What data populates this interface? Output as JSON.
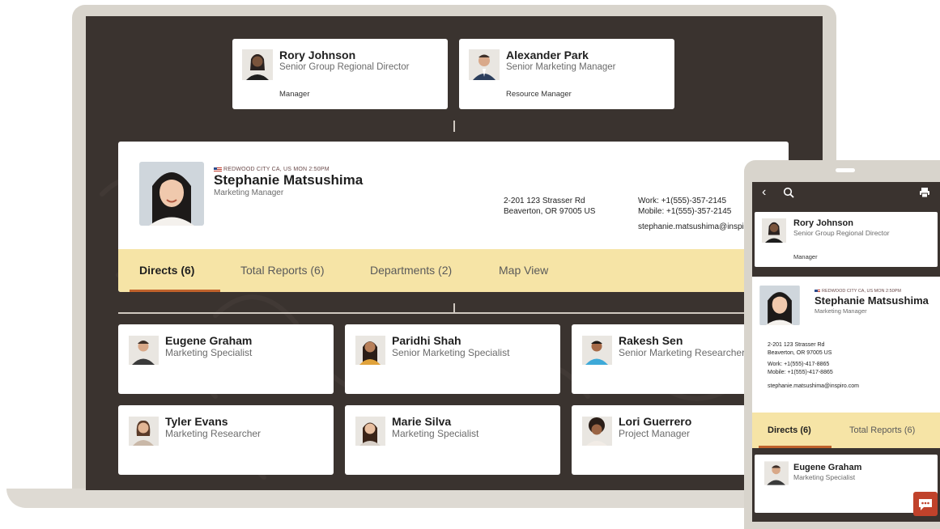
{
  "managers": [
    {
      "name": "Rory Johnson",
      "title": "Senior Group Regional Director",
      "role": "Manager"
    },
    {
      "name": "Alexander Park",
      "title": "Senior Marketing Manager",
      "role": "Resource Manager"
    }
  ],
  "profile": {
    "location": "REDWOOD CITY CA, US MON 2:50PM",
    "name": "Stephanie Matsushima",
    "title": "Marketing Manager",
    "address_line1": "2-201 123 Strasser Rd",
    "address_line2": "Beaverton, OR 97005 US",
    "work_phone": "Work: +1(555)-357-2145",
    "mobile_phone": "Mobile: +1(555)-357-2145",
    "email": "stephanie.matsushima@inspi"
  },
  "tabs": [
    {
      "label": "Directs (6)",
      "active": true
    },
    {
      "label": "Total Reports (6)",
      "active": false
    },
    {
      "label": "Departments (2)",
      "active": false
    },
    {
      "label": "Map View",
      "active": false
    }
  ],
  "directs": [
    {
      "name": "Eugene Graham",
      "title": "Marketing Specialist"
    },
    {
      "name": "Paridhi Shah",
      "title": "Senior Marketing Specialist"
    },
    {
      "name": "Rakesh Sen",
      "title": "Senior Marketing Researcher"
    },
    {
      "name": "Tyler Evans",
      "title": "Marketing Researcher"
    },
    {
      "name": "Marie Silva",
      "title": "Marketing Specialist"
    },
    {
      "name": "Lori Guerrero",
      "title": "Project Manager"
    }
  ],
  "tablet": {
    "icons": [
      "back-chevron-icon",
      "search-icon",
      "print-icon"
    ],
    "manager": {
      "name": "Rory Johnson",
      "title": "Senior Group Regional Director",
      "role": "Manager"
    },
    "profile": {
      "location": "REDWOOD CITY CA, US MON 2:50PM",
      "name": "Stephanie Matsushima",
      "title": "Marketing Manager",
      "address_line1": "2-201 123 Strasser Rd",
      "address_line2": "Beaverton, OR 97005 US",
      "work_phone": "Work: +1(555)-417-8865",
      "mobile_phone": "Mobile: +1(555)-417-8865",
      "email": "stephanie.matsushima@inspiro.com"
    },
    "tabs": [
      {
        "label": "Directs (6)",
        "active": true
      },
      {
        "label": "Total Reports (6)",
        "active": false
      }
    ],
    "first_direct": {
      "name": "Eugene Graham",
      "title": "Marketing Specialist"
    }
  },
  "colors": {
    "screen_background": "#3a332f",
    "tab_bar": "#f6e4a6",
    "tab_underline": "#c0622b",
    "chat_button": "#c0422b"
  }
}
